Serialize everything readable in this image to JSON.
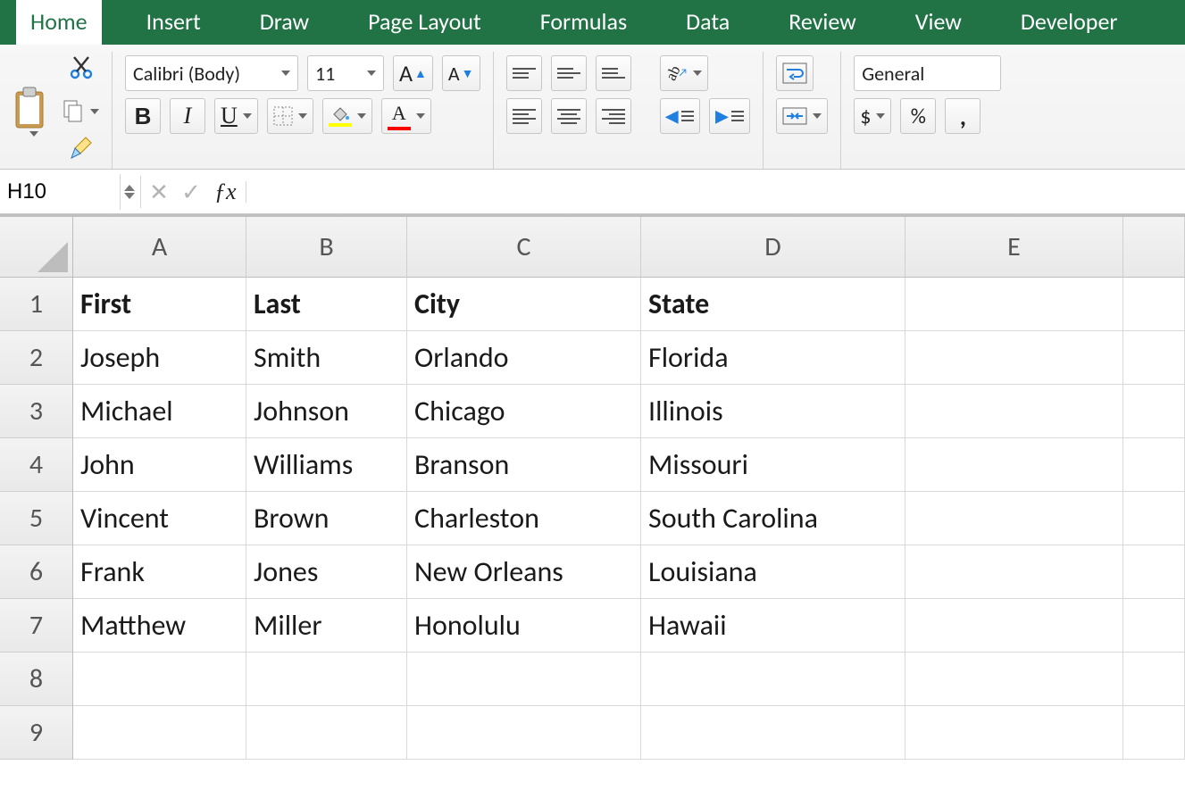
{
  "tabs": [
    "Home",
    "Insert",
    "Draw",
    "Page Layout",
    "Formulas",
    "Data",
    "Review",
    "View",
    "Developer"
  ],
  "active_tab_index": 0,
  "clipboard": {
    "paste_label": "Paste"
  },
  "font": {
    "name": "Calibri (Body)",
    "size": "11"
  },
  "number_format": "General",
  "name_box": "H10",
  "formula_bar": "",
  "columns": [
    "A",
    "B",
    "C",
    "D",
    "E"
  ],
  "col_widths": [
    "cA",
    "cB",
    "cC",
    "cD",
    "cE",
    "cF"
  ],
  "row_numbers": [
    "1",
    "2",
    "3",
    "4",
    "5",
    "6",
    "7",
    "8",
    "9"
  ],
  "chart_data": {
    "type": "table",
    "headers": [
      "First",
      "Last",
      "City",
      "State"
    ],
    "rows": [
      [
        "Joseph",
        "Smith",
        "Orlando",
        "Florida"
      ],
      [
        "Michael",
        "Johnson",
        "Chicago",
        "Illinois"
      ],
      [
        "John",
        "Williams",
        "Branson",
        "Missouri"
      ],
      [
        "Vincent",
        "Brown",
        "Charleston",
        "South Carolina"
      ],
      [
        "Frank",
        "Jones",
        "New Orleans",
        "Louisiana"
      ],
      [
        "Matthew",
        "Miller",
        "Honolulu",
        "Hawaii"
      ]
    ]
  },
  "currency_symbol": "$",
  "percent_symbol": "%"
}
